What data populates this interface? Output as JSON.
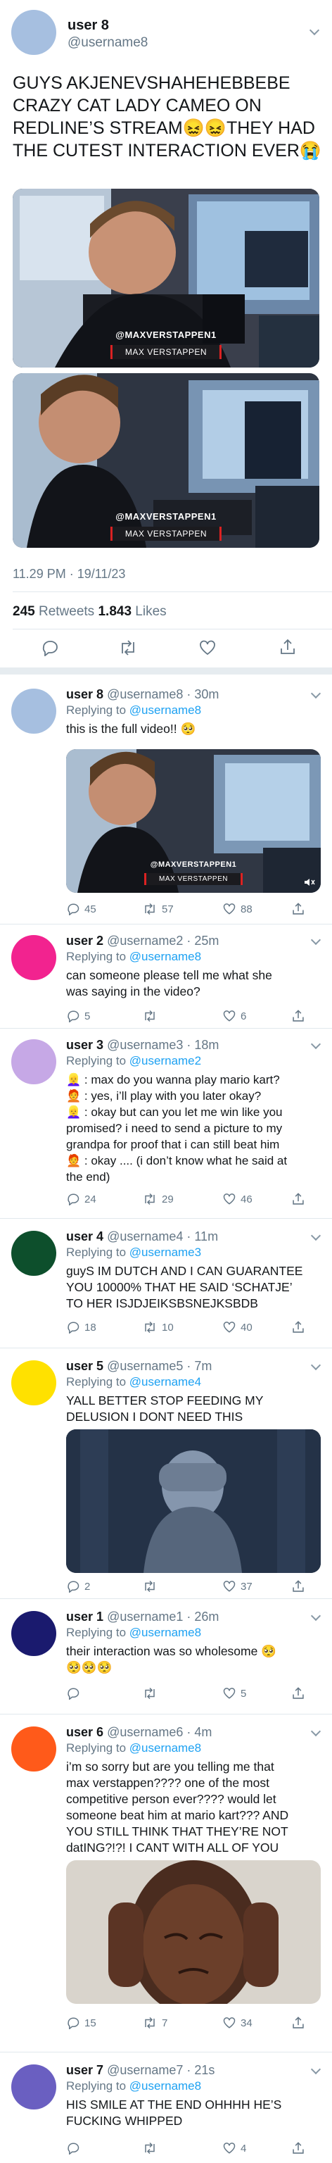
{
  "main": {
    "name": "user 8",
    "handle": "@username8",
    "text_lines": [
      "GUYS AKJENEVSHAHEHEBBEBE",
      "CRAZY CAT LADY CAMEO ON",
      "REDLINE’S STREAM😖😖THEY HAD",
      "THE CUTEST INTERACTION EVER😭"
    ],
    "photo1": {
      "watermark": "@MAXVERSTAPPEN1",
      "namebar": "MAX VERSTAPPEN"
    },
    "photo2": {
      "watermark": "@MAXVERSTAPPEN1",
      "namebar": "MAX VERSTAPPEN"
    },
    "timestamp": "11.29 PM · 19/11/23",
    "retweets_count": "245",
    "retweets_label": "Retweets",
    "likes_count": "1.843",
    "likes_label": "Likes"
  },
  "replies": [
    {
      "name": "user 8",
      "meta": "@username8 · 30m",
      "replying_prefix": "Replying to ",
      "replying_to": "@username8",
      "lines": [
        "this is the full video!! 🥺"
      ],
      "media": {
        "watermark": "@MAXVERSTAPPEN1",
        "namebar": "MAX VERSTAPPEN"
      },
      "replies": "45",
      "retweets": "57",
      "likes": "88",
      "avatar_color": "#a6bfe0"
    },
    {
      "name": "user 2",
      "meta": "@username2 · 25m",
      "replying_prefix": "Replying to ",
      "replying_to": "@username8",
      "lines": [
        "can someone please tell me what she",
        "was saying in the video?"
      ],
      "replies": "5",
      "retweets": "",
      "likes": "6",
      "avatar_color": "#f2238f"
    },
    {
      "name": "user 3",
      "meta": "@username3 · 18m",
      "replying_prefix": "Replying to ",
      "replying_to": "@username2",
      "lines": [
        "👱‍♀️ : max do you wanna play mario kart?",
        "🧑‍🦰 : yes, i’ll play with you later okay?",
        "👱‍♀️ : okay but can you let me win like you",
        "promised? i need to send a picture to my",
        "grandpa for proof that i can still beat him",
        "🧑‍🦰 : okay .... (i don’t know what he said at",
        "the end)"
      ],
      "replies": "24",
      "retweets": "29",
      "likes": "46",
      "avatar_color": "#c6a8e6"
    },
    {
      "name": "user 4",
      "meta": "@username4 · 11m",
      "replying_prefix": "Replying to ",
      "replying_to": "@username3",
      "lines": [
        "guyS IM DUTCH AND I CAN GUARANTEE",
        "YOU 10000% THAT HE SAID ‘SCHATJE’",
        "TO HER ISJDJEIKSBSNEJKSBDB"
      ],
      "replies": "18",
      "retweets": "10",
      "likes": "40",
      "avatar_color": "#0d4f2c"
    },
    {
      "name": "user 5",
      "meta": "@username5 · 7m",
      "replying_prefix": "Replying to ",
      "replying_to": "@username4",
      "lines": [
        "YALL BETTER STOP FEEDING MY",
        "DELUSION I DONT NEED THIS"
      ],
      "replies": "2",
      "retweets": "",
      "likes": "37",
      "avatar_color": "#ffe100"
    },
    {
      "name": "user 1",
      "meta": "@username1 · 26m",
      "replying_prefix": "Replying to ",
      "replying_to": "@username8",
      "lines": [
        "their interaction was so wholesome 🥺",
        "🥺🥺🥺"
      ],
      "replies": "",
      "retweets": "",
      "likes": "5",
      "avatar_color": "#1a1a6e"
    },
    {
      "name": "user 6",
      "meta": "@username6 · 4m",
      "replying_prefix": "Replying to ",
      "replying_to": "@username8",
      "lines": [
        "i’m so sorry but are you telling me that",
        "max verstappen???? one of the most",
        "competitive person ever???? would let",
        "someone beat him at mario kart??? AND",
        "YOU STILL THINK THAT THEY’RE NOT",
        "datING?!?! I CANT WITH ALL OF YOU"
      ],
      "replies": "15",
      "retweets": "7",
      "likes": "34",
      "avatar_color": "#ff5a1a"
    },
    {
      "name": "user 7",
      "meta": "@username7 · 21s",
      "replying_prefix": "Replying to ",
      "replying_to": "@username8",
      "lines": [
        "HIS SMILE AT THE END OHHHH HE’S",
        "FUCKING WHIPPED"
      ],
      "replies": "",
      "retweets": "",
      "likes": "4",
      "avatar_color": "#6a5fc1"
    }
  ],
  "icons": {
    "reply": "reply-icon",
    "retweet": "retweet-icon",
    "like": "heart-icon",
    "share": "share-icon",
    "more": "chevron-down-icon",
    "volume": "speaker-icon"
  },
  "colors": {
    "link": "#1da1f2",
    "secondary": "#657786",
    "divider": "#e1e8ed"
  }
}
